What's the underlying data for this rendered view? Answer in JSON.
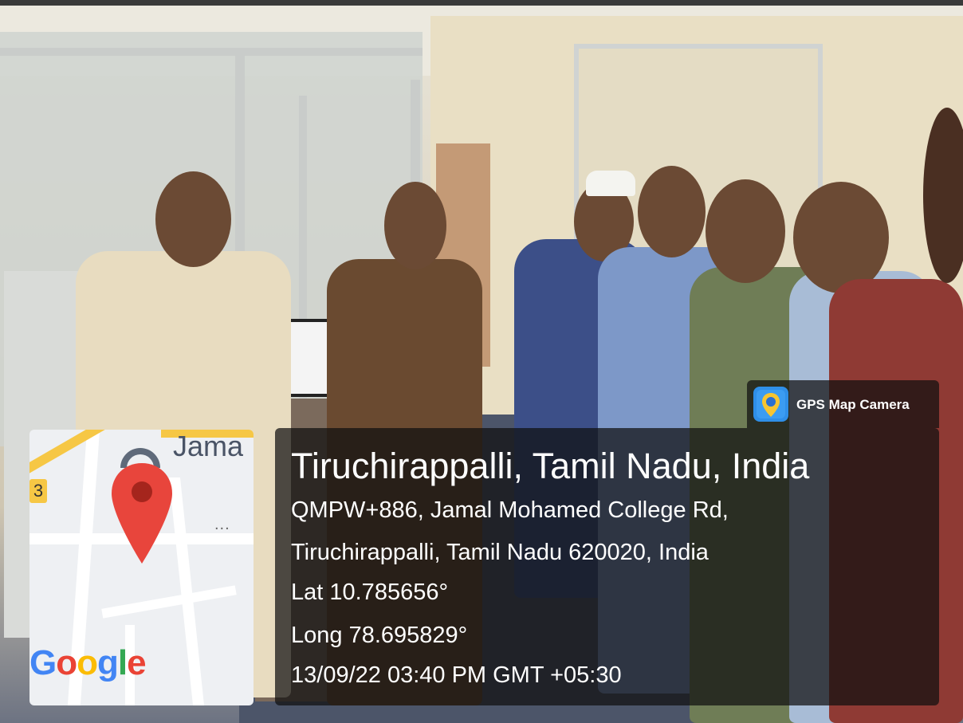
{
  "overlay": {
    "app_name": "GPS Map Camera",
    "location_title": "Tiruchirappalli, Tamil Nadu, India",
    "address_line1": "QMPW+886, Jamal Mohamed College Rd,",
    "address_line2": "Tiruchirappalli, Tamil Nadu 620020, India",
    "latitude": "Lat 10.785656°",
    "longitude": "Long 78.695829°",
    "timestamp": "13/09/22 03:40 PM GMT +05:30"
  },
  "map": {
    "place_label": "Jama",
    "route_number": "3",
    "more_dots": "...",
    "google_logo": {
      "G": "G",
      "o1": "o",
      "o2": "o",
      "g": "g",
      "l": "l",
      "e": "e"
    },
    "colors": {
      "pin": "#e8453c",
      "road_yellow": "#f6c745",
      "blue": "#4285f4",
      "red": "#ea4335",
      "yellow": "#fbbc05",
      "green": "#34a853"
    }
  },
  "colors": {
    "panel_bg": "rgba(15,15,15,0.72)",
    "text": "#ffffff"
  }
}
